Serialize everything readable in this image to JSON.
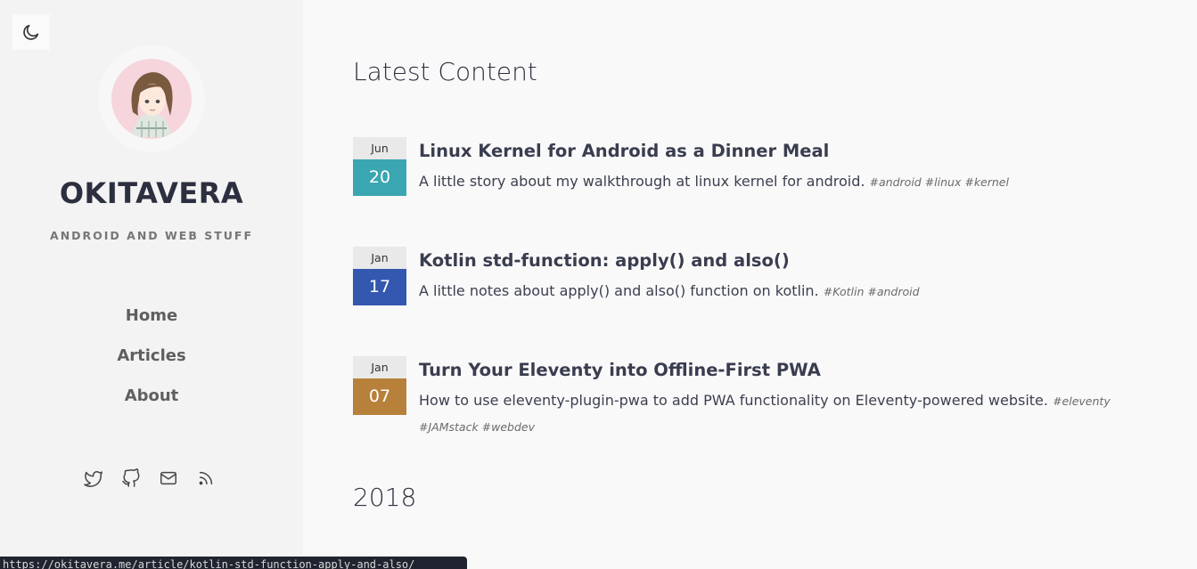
{
  "sidebar": {
    "theme_toggle_icon": "moon-icon",
    "avatar_icon": "avatar-illustration",
    "title": "OKITAVERA",
    "tagline": "ANDROID AND WEB STUFF",
    "nav": [
      {
        "label": "Home"
      },
      {
        "label": "Articles"
      },
      {
        "label": "About"
      }
    ],
    "socials": [
      "twitter-icon",
      "github-icon",
      "mail-icon",
      "rss-icon"
    ]
  },
  "main": {
    "title": "Latest Content",
    "posts": [
      {
        "month": "Jun",
        "day": "20",
        "color": "#3aa6b1",
        "title": "Linux Kernel for Android as a Dinner Meal",
        "description": "A little story about my walkthrough at linux kernel for android.",
        "tags": "#android #linux #kernel"
      },
      {
        "month": "Jan",
        "day": "17",
        "color": "#3457b0",
        "title": "Kotlin std-function: apply() and also()",
        "description": "A little notes about apply() and also() function on kotlin.",
        "tags": "#Kotlin #android"
      },
      {
        "month": "Jan",
        "day": "07",
        "color": "#b8813b",
        "title": "Turn Your Eleventy into Offline-First PWA",
        "description": "How to use eleventy-plugin-pwa to add PWA functionality on Eleventy-powered website.",
        "tags": "#eleventy #JAMstack #webdev"
      }
    ],
    "year_heading": "2018"
  },
  "status_bar": {
    "url": "https://okitavera.me/article/kotlin-std-function-apply-and-also/"
  }
}
